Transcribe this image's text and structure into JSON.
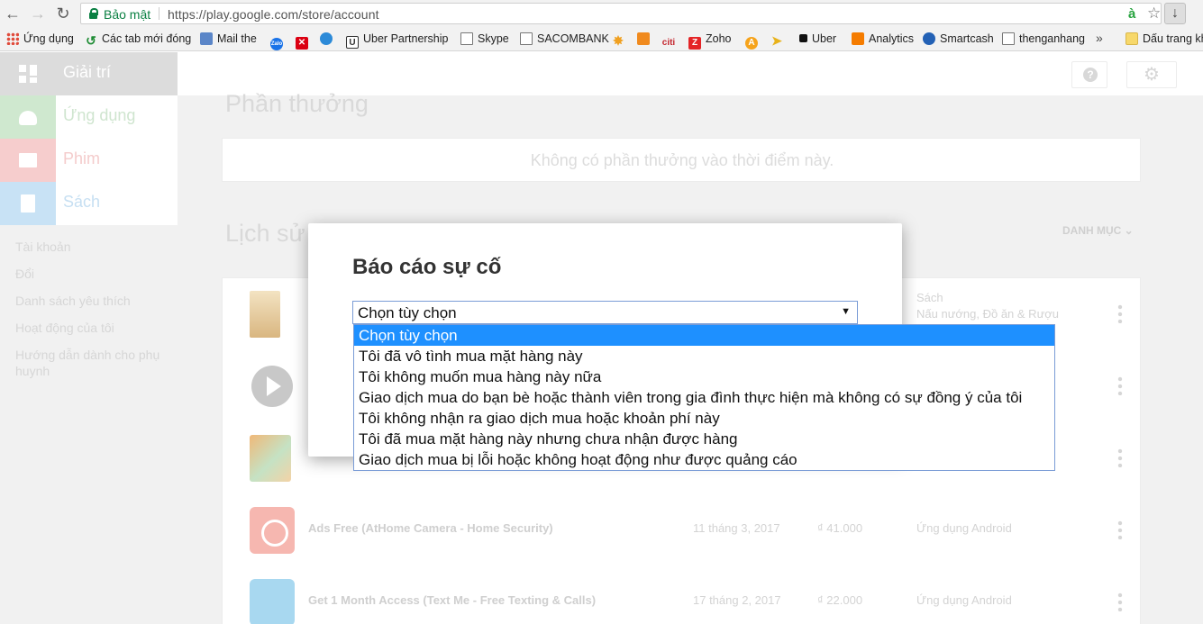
{
  "browser": {
    "secure_label": "Bảo mật",
    "url": "https://play.google.com/store/account",
    "ext_icon": "à",
    "star_icon": "☆",
    "download_icon": "↓",
    "back_icon": "←",
    "forward_icon": "→",
    "reload_icon": "↻"
  },
  "bookmarks": {
    "items": [
      {
        "label": "Ứng dụng",
        "icon": "apps-icon"
      },
      {
        "label": "Các tab mới đóng",
        "icon": "history-icon"
      },
      {
        "label": "Mail the",
        "icon": "mail-icon"
      },
      {
        "label": "",
        "icon": "zalo-icon"
      },
      {
        "label": "",
        "icon": "hsbc-icon"
      },
      {
        "label": "",
        "icon": "globe-icon"
      },
      {
        "label": "Uber Partnership",
        "icon": "uber-icon"
      },
      {
        "label": "Skype",
        "icon": "page-icon"
      },
      {
        "label": "SACOMBANK",
        "icon": "page-icon"
      },
      {
        "label": "",
        "icon": "star-badge-icon"
      },
      {
        "label": "",
        "icon": "triangle-icon"
      },
      {
        "label": "",
        "icon": "citi-icon"
      },
      {
        "label": "Zoho",
        "icon": "zoho-icon"
      },
      {
        "label": "",
        "icon": "a-circle-icon"
      },
      {
        "label": "",
        "icon": "arrow-icon"
      },
      {
        "label": "Uber",
        "icon": "black-square-icon"
      },
      {
        "label": "Analytics",
        "icon": "analytics-icon"
      },
      {
        "label": "Smartcash",
        "icon": "smartcash-icon"
      },
      {
        "label": "thenganhang",
        "icon": "page-icon"
      },
      {
        "label": "Dấu trang khác",
        "icon": "folder-icon"
      }
    ],
    "more": "»",
    "tile_text": {
      "zalo": "Zalo",
      "hsbc": "✕",
      "uber": "U",
      "citi": "citi",
      "zoho": "Z",
      "circle_a": "A",
      "arrow": "➤",
      "star": "✸",
      "tabs": "↺"
    }
  },
  "play": {
    "categories": [
      {
        "label": "Giải trí"
      },
      {
        "label": "Ứng dụng"
      },
      {
        "label": "Phim"
      },
      {
        "label": "Sách"
      }
    ],
    "side_links": [
      "Tài khoản",
      "Đổi",
      "Danh sách yêu thích",
      "Hoạt động của tôi",
      "Hướng dẫn dành cho phụ huynh"
    ],
    "settings_icon": "⚙",
    "rewards_title": "Phần thưởng",
    "rewards_empty": "Không có phần thưởng vào thời điểm này.",
    "history_title": "Lịch sử",
    "category_filter": "DANH MỤC ⌄",
    "history_rows": [
      {
        "title": "",
        "date": "",
        "price": "",
        "type": "Sách",
        "type2": "Nấu nướng, Đồ ăn & Rượu"
      },
      {
        "title": "",
        "date": "",
        "price": "",
        "type": "",
        "type2": ""
      },
      {
        "title": "",
        "date": "",
        "price": "",
        "type": "",
        "type2": ""
      },
      {
        "title": "Ads Free (AtHome Camera - Home Security)",
        "date": "11 tháng 3, 2017",
        "price": "₫ 41.000",
        "type": "Ứng dụng Android",
        "type2": ""
      },
      {
        "title": "Get 1 Month Access (Text Me - Free Texting & Calls)",
        "date": "17 tháng 2, 2017",
        "price": "₫ 22.000",
        "type": "Ứng dụng Android",
        "type2": ""
      }
    ]
  },
  "dialog": {
    "title": "Báo cáo sự cố",
    "select_value": "Chọn tùy chọn",
    "select_arrow": "▼",
    "options": [
      "Chọn tùy chọn",
      "Tôi đã vô tình mua mặt hàng này",
      "Tôi không muốn mua hàng này nữa",
      "Giao dịch mua do bạn bè hoặc thành viên trong gia đình thực hiện mà không có sự đồng ý của tôi",
      "Tôi không nhận ra giao dịch mua hoặc khoản phí này",
      "Tôi đã mua mặt hàng này nhưng chưa nhận được hàng",
      "Giao dịch mua bị lỗi hoặc không hoạt động như được quảng cáo"
    ],
    "selected_index": 0
  },
  "colors": {
    "secure_green": "#0b8043",
    "selection_blue": "#1e90ff",
    "select_border": "#7a9cd6"
  }
}
